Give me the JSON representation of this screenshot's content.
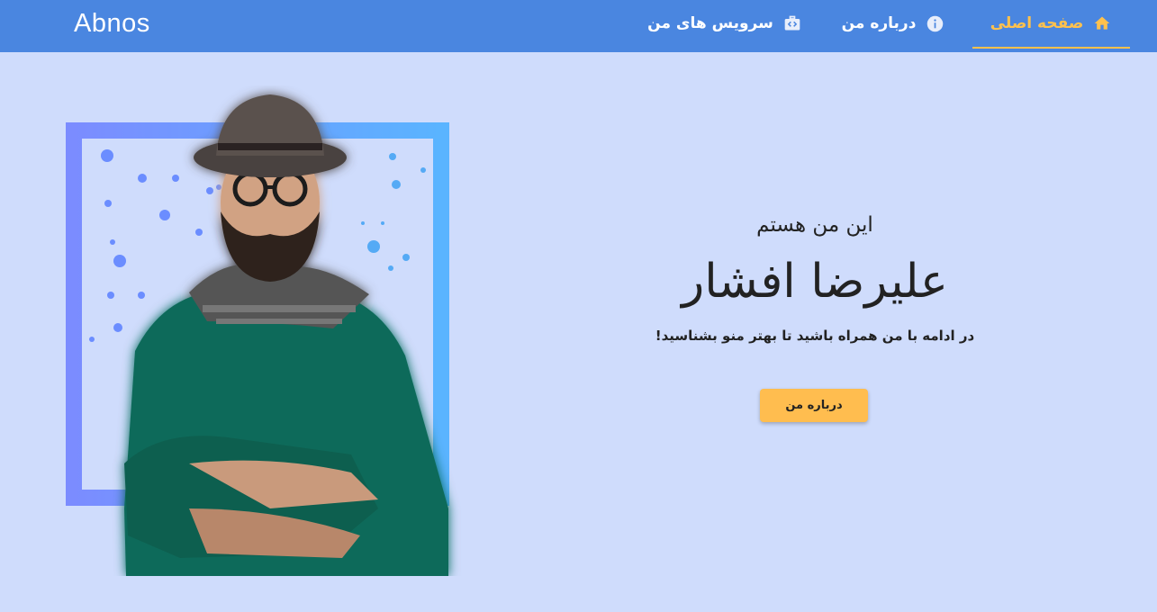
{
  "brand": "Abnos",
  "nav": {
    "items": [
      {
        "label": "صفحه اصلی",
        "icon": "home-icon",
        "active": true
      },
      {
        "label": "درباره من",
        "icon": "info-icon",
        "active": false
      },
      {
        "label": "سرویس های من",
        "icon": "code-briefcase-icon",
        "active": false
      }
    ]
  },
  "hero": {
    "subtitle": "این من هستم",
    "name": "علیرضا افشار",
    "tagline": "در ادامه با من همراه باشید تا بهتر منو بشناسید!",
    "button_label": "درباره من"
  },
  "colors": {
    "navbar": "#4a86e0",
    "background": "#cfdcfc",
    "accent": "#ffc14d",
    "button": "#ffbd4f"
  }
}
